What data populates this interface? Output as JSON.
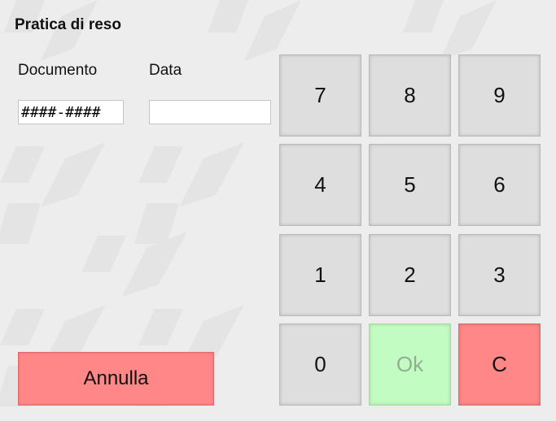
{
  "header": {
    "title": "Pratica di reso"
  },
  "form": {
    "document_label": "Documento",
    "document_value": "####-####",
    "date_label": "Data",
    "date_value": ""
  },
  "keypad": {
    "keys": [
      "7",
      "8",
      "9",
      "4",
      "5",
      "6",
      "1",
      "2",
      "3",
      "0",
      "Ok",
      "C"
    ],
    "ok_disabled": true
  },
  "actions": {
    "cancel_label": "Annulla"
  },
  "colors": {
    "background": "#ededed",
    "key": "#dedede",
    "ok_key": "#c3fcc3",
    "clear_key": "#ff8787",
    "cancel_button": "#ff8787"
  },
  "icons": {
    "background_watermark": "brand-logo-watermark-icon"
  }
}
